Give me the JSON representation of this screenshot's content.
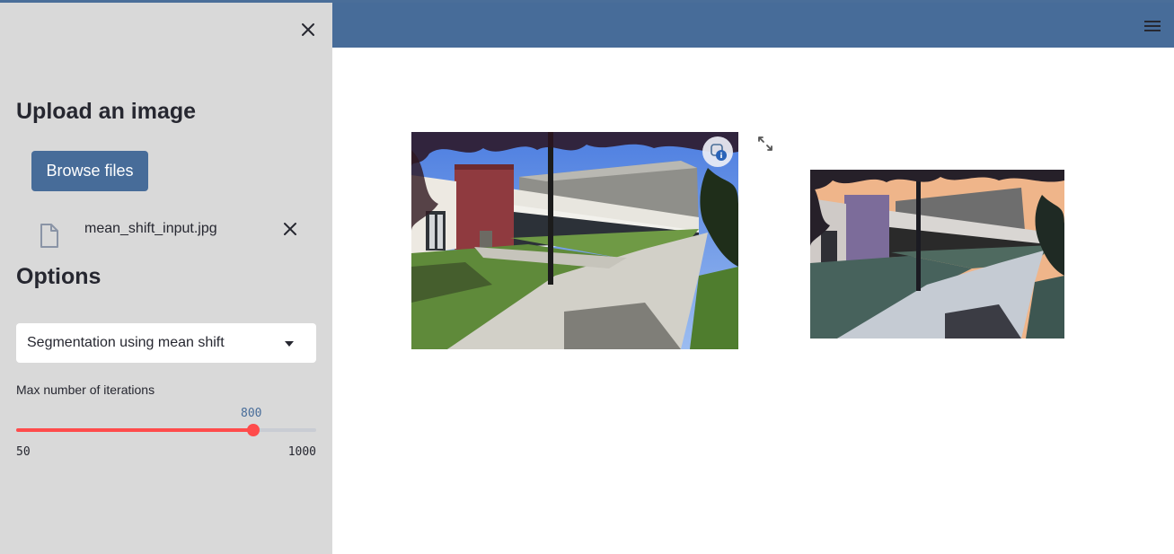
{
  "sidebar": {
    "upload_heading": "Upload an image",
    "browse_button": "Browse files",
    "uploaded_file": {
      "name": "mean_shift_input.jpg"
    },
    "options_heading": "Options",
    "method_select": {
      "value": "Segmentation using mean shift"
    },
    "iterations_slider": {
      "label": "Max number of iterations",
      "value": 800,
      "value_label": "800",
      "min": 50,
      "min_label": "50",
      "max": 1000,
      "max_label": "1000"
    }
  },
  "icons": {
    "close_sidebar": "close-icon",
    "menu": "hamburger-menu-icon",
    "file": "file-icon",
    "remove_file": "close-icon",
    "select_caret": "caret-down-icon",
    "fullscreen": "expand-icon"
  },
  "colors": {
    "header": "#476c99",
    "sidebar": "#d9d9d9",
    "primary_button": "#476c99",
    "slider_accent": "#ff4b4b",
    "slider_value": "#476c99"
  }
}
